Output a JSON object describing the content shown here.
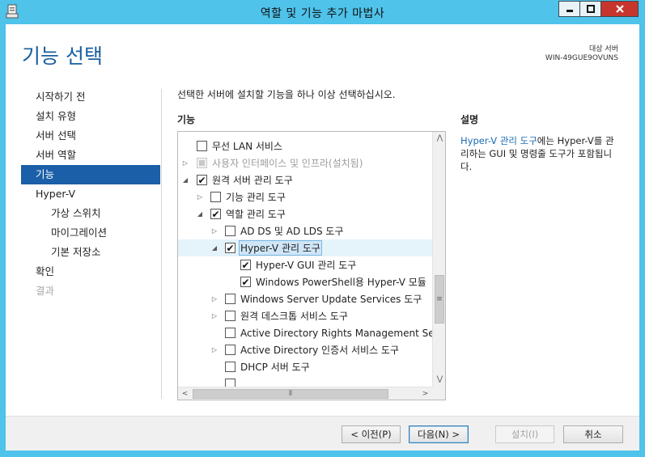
{
  "window": {
    "title": "역할 및 기능 추가 마법사"
  },
  "header": {
    "page_title": "기능 선택",
    "destination_label": "대상 서버",
    "destination_server": "WIN-49GUE9OVUNS"
  },
  "nav": {
    "items": [
      {
        "label": "시작하기 전",
        "state": "normal"
      },
      {
        "label": "설치 유형",
        "state": "normal"
      },
      {
        "label": "서버 선택",
        "state": "normal"
      },
      {
        "label": "서버 역할",
        "state": "normal"
      },
      {
        "label": "기능",
        "state": "active"
      },
      {
        "label": "Hyper-V",
        "state": "normal"
      },
      {
        "label": "가상 스위치",
        "state": "sub"
      },
      {
        "label": "마이그레이션",
        "state": "sub"
      },
      {
        "label": "기본 저장소",
        "state": "sub"
      },
      {
        "label": "확인",
        "state": "normal"
      },
      {
        "label": "결과",
        "state": "disabled"
      }
    ]
  },
  "main": {
    "instruction": "선택한 서버에 설치할 기능을 하나 이상 선택하십시오.",
    "features_label": "기능",
    "features": [
      {
        "label": "무선 LAN 서비스",
        "checked": "unchecked",
        "expander": "none"
      },
      {
        "label": "사용자 인터페이스 및 인프라(설치됨)",
        "checked": "indeterminate",
        "expander": "collapsed",
        "disabled": true
      },
      {
        "label": "원격 서버 관리 도구",
        "checked": "checked",
        "expander": "expanded"
      },
      {
        "label": "기능 관리 도구",
        "checked": "unchecked",
        "expander": "collapsed"
      },
      {
        "label": "역할 관리 도구",
        "checked": "checked",
        "expander": "expanded"
      },
      {
        "label": "AD DS 및 AD LDS 도구",
        "checked": "unchecked",
        "expander": "collapsed"
      },
      {
        "label": "Hyper-V 관리 도구",
        "checked": "checked",
        "expander": "expanded",
        "selected": true
      },
      {
        "label": "Hyper-V GUI 관리 도구",
        "checked": "checked",
        "expander": "none"
      },
      {
        "label": "Windows PowerShell용 Hyper-V 모듈",
        "checked": "checked",
        "expander": "none"
      },
      {
        "label": "Windows Server Update Services 도구",
        "checked": "unchecked",
        "expander": "collapsed"
      },
      {
        "label": "원격 데스크톱 서비스 도구",
        "checked": "unchecked",
        "expander": "collapsed"
      },
      {
        "label": "Active Directory Rights Management Serv",
        "checked": "unchecked",
        "expander": "none"
      },
      {
        "label": "Active Directory 인증서 서비스 도구",
        "checked": "unchecked",
        "expander": "collapsed"
      },
      {
        "label": "DHCP 서버 도구",
        "checked": "unchecked",
        "expander": "none"
      }
    ],
    "description_label": "설명",
    "description_link": "Hyper-V 관리 도구",
    "description_text": "에는 Hyper-V를 관리하는 GUI 및 명령줄 도구가 포함됩니다."
  },
  "footer": {
    "prev_label": "< 이전(P)",
    "next_label": "다음(N) >",
    "install_label": "설치(I)",
    "cancel_label": "취소"
  },
  "colors": {
    "titlebar": "#4fc3ea",
    "accent": "#1b5fa8",
    "title_text": "#1a5fa0",
    "close_button": "#c7362d"
  }
}
